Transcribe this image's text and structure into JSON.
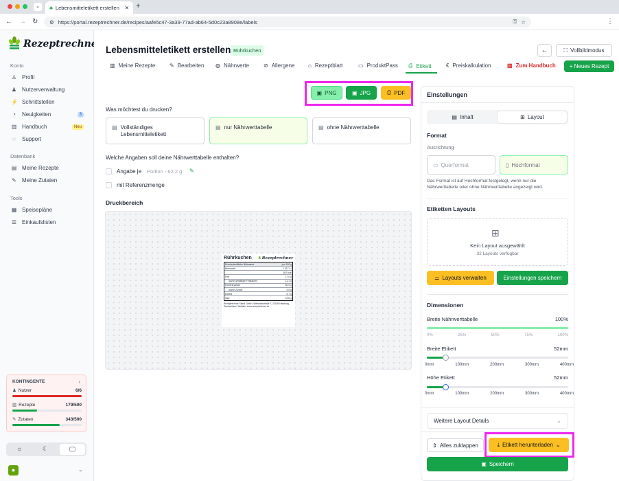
{
  "browser": {
    "tab_title": "Lebensmitteletikett erstellen",
    "url": "https://portal.rezeptrechner.de/recipes/aafe5c47-3a39-77ad-ab64-5d0c23a8908e/labels"
  },
  "brand": {
    "name": "Rezeptrechner"
  },
  "sidebar": {
    "konto_title": "Konto",
    "konto": [
      {
        "label": "Profil",
        "icon": "user-icon"
      },
      {
        "label": "Nutzerverwaltung",
        "icon": "users-icon"
      },
      {
        "label": "Schnittstellen",
        "icon": "plug-icon"
      },
      {
        "label": "Neuigkeiten",
        "icon": "news-icon",
        "badge": "3"
      },
      {
        "label": "Handbuch",
        "icon": "book-icon",
        "badge": "Neu"
      },
      {
        "label": "Support",
        "icon": "help-icon"
      }
    ],
    "daten_title": "Datenbank",
    "daten": [
      {
        "label": "Meine Rezepte",
        "icon": "book-open-icon"
      },
      {
        "label": "Meine Zutaten",
        "icon": "carrot-icon"
      }
    ],
    "tools_title": "Tools",
    "tools": [
      {
        "label": "Speisepläne",
        "icon": "calendar-icon"
      },
      {
        "label": "Einkaufslisten",
        "icon": "list-icon"
      }
    ],
    "kontingente": {
      "title": "KONTINGENTE",
      "rows": [
        {
          "label": "Nutzer",
          "value": "6/6",
          "fill": 1.0,
          "color": "#dc2626"
        },
        {
          "label": "Rezepte",
          "value": "179/500",
          "fill": 0.358,
          "color": "#16a34a"
        },
        {
          "label": "Zutaten",
          "value": "343/500",
          "fill": 0.686,
          "color": "#16a34a"
        }
      ]
    }
  },
  "header": {
    "title": "Lebensmitteletikett erstellen",
    "recipe_tag": "Rührkuchen",
    "fullscreen": "Vollbildmodus",
    "tabs": [
      {
        "label": "Meine Rezepte",
        "icon": "book-icon"
      },
      {
        "label": "Bearbeiten",
        "icon": "edit-icon"
      },
      {
        "label": "Nährwerte",
        "icon": "apple-icon"
      },
      {
        "label": "Allergene",
        "icon": "no-wheat-icon"
      },
      {
        "label": "Rezeptblatt",
        "icon": "hat-icon"
      },
      {
        "label": "ProduktPass",
        "icon": "pass-icon"
      },
      {
        "label": "Etikett",
        "icon": "printer-icon",
        "active": true
      },
      {
        "label": "Preiskalkulation",
        "icon": "euro-icon"
      },
      {
        "label": "Zum Handbuch",
        "icon": "book-red-icon"
      }
    ],
    "new_recipe": "+ Neues Rezept"
  },
  "export": {
    "png": "PNG",
    "jpg": "JPG",
    "pdf": "PDF"
  },
  "print": {
    "question": "Was möchtest du drucken?",
    "options": [
      "Vollständiges Lebensmitteletikett",
      "nur Nährwerttabelle",
      "ohne Nährwerttabelle"
    ],
    "selected": 1,
    "nutri_question": "Welche Angaben soll deine Nährwerttabelle enthalten?",
    "angabe_label": "Angabe je",
    "angabe_value": "Portion - 62,2 g",
    "referenz_label": "mit Referenzmenge",
    "druckbereich": "Druckbereich"
  },
  "label_preview": {
    "title": "Rührkuchen",
    "header_left": "Durchschnittliche Nährwerte",
    "header_right": "pro 100 g",
    "rows": [
      {
        "k": "Brennwert",
        "v": "1.517 kJ"
      },
      {
        "k": "",
        "v": "362 kcal"
      },
      {
        "k": "Fett",
        "v": "17,0 g"
      },
      {
        "k": "davon gesättigte Fettsäuren",
        "v": "11,1 g"
      },
      {
        "k": "Kohlenhydrate",
        "v": "50,0 g"
      },
      {
        "k": "davon Zucker",
        "v": "9,5 g"
      },
      {
        "k": "Eiweiß",
        "v": "6,7 g"
      },
      {
        "k": "Salz",
        "v": "0,26 g"
      }
    ],
    "footer": "Rezeptrechner Stand GmbH, Weitmarkstraße 7, 22045 Hamburg, Deutschland, Website: www.rezeptrechner.de"
  },
  "settings": {
    "title": "Einstellungen",
    "tab_inhalt": "Inhalt",
    "tab_layout": "Layout",
    "format_title": "Format",
    "ausrichtung": "Ausrichtung",
    "quer": "Querformat",
    "hoch": "Hochformat",
    "format_note": "Das Format ist auf Hochformat festgelegt, wenn nur die Nährwerttabelle oder ohne Nährwerttabelle angezeigt wird.",
    "layouts_title": "Etiketten Layouts",
    "no_layout": "Kein Layout ausgewählt",
    "layouts_count": "32 Layouts verfügbar",
    "manage": "Layouts verwalten",
    "save_settings": "Einstellungen speichern",
    "dim_title": "Dimensionen",
    "breite_tab_label": "Breite Nährwerttabelle",
    "breite_tab_value": "100%",
    "breite_tab_fill": 1.0,
    "pct_ticks": [
      "0%",
      "25%",
      "50%",
      "75%",
      "100%"
    ],
    "breite_etikett_label": "Breite Etikett",
    "breite_etikett_value": "52mm",
    "breite_etikett_fill": 0.13,
    "hoehe_etikett_label": "Höhe Etikett",
    "hoehe_etikett_value": "52mm",
    "hoehe_etikett_fill": 0.13,
    "mm_ticks": [
      "0mm",
      "100mm",
      "200mm",
      "300mm",
      "400mm"
    ],
    "weitere": "Weitere Layout Details",
    "collapse": "Alles zuklappen",
    "download": "Etikett herunterladen",
    "save": "Speichern"
  }
}
